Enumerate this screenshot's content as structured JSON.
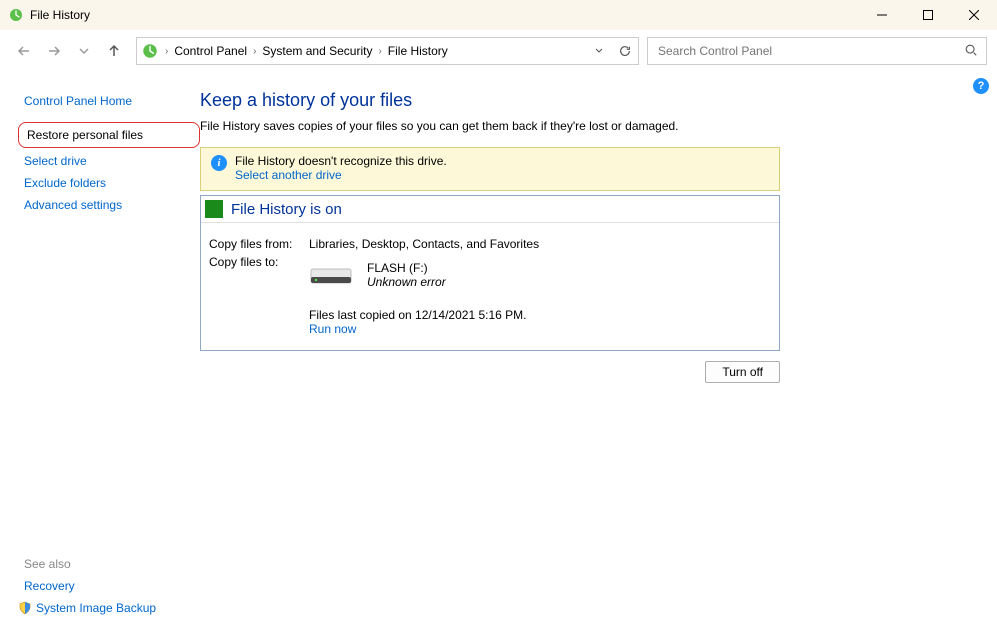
{
  "titlebar": {
    "title": "File History"
  },
  "breadcrumb": {
    "items": [
      "Control Panel",
      "System and Security",
      "File History"
    ]
  },
  "search": {
    "placeholder": "Search Control Panel"
  },
  "sidebar": {
    "home": "Control Panel Home",
    "restore": "Restore personal files",
    "select_drive": "Select drive",
    "exclude": "Exclude folders",
    "advanced": "Advanced settings",
    "see_also": "See also",
    "recovery": "Recovery",
    "system_image": "System Image Backup"
  },
  "main": {
    "heading": "Keep a history of your files",
    "description": "File History saves copies of your files so you can get them back if they're lost or damaged.",
    "warning_text": "File History doesn't recognize this drive.",
    "warning_link": "Select another drive",
    "status_title": "File History is on",
    "copy_from_label": "Copy files from:",
    "copy_from_value": "Libraries, Desktop, Contacts, and Favorites",
    "copy_to_label": "Copy files to:",
    "drive_name": "FLASH (F:)",
    "drive_error": "Unknown error",
    "last_copied": "Files last copied on 12/14/2021 5:16 PM.",
    "run_now": "Run now",
    "turn_off": "Turn off"
  }
}
